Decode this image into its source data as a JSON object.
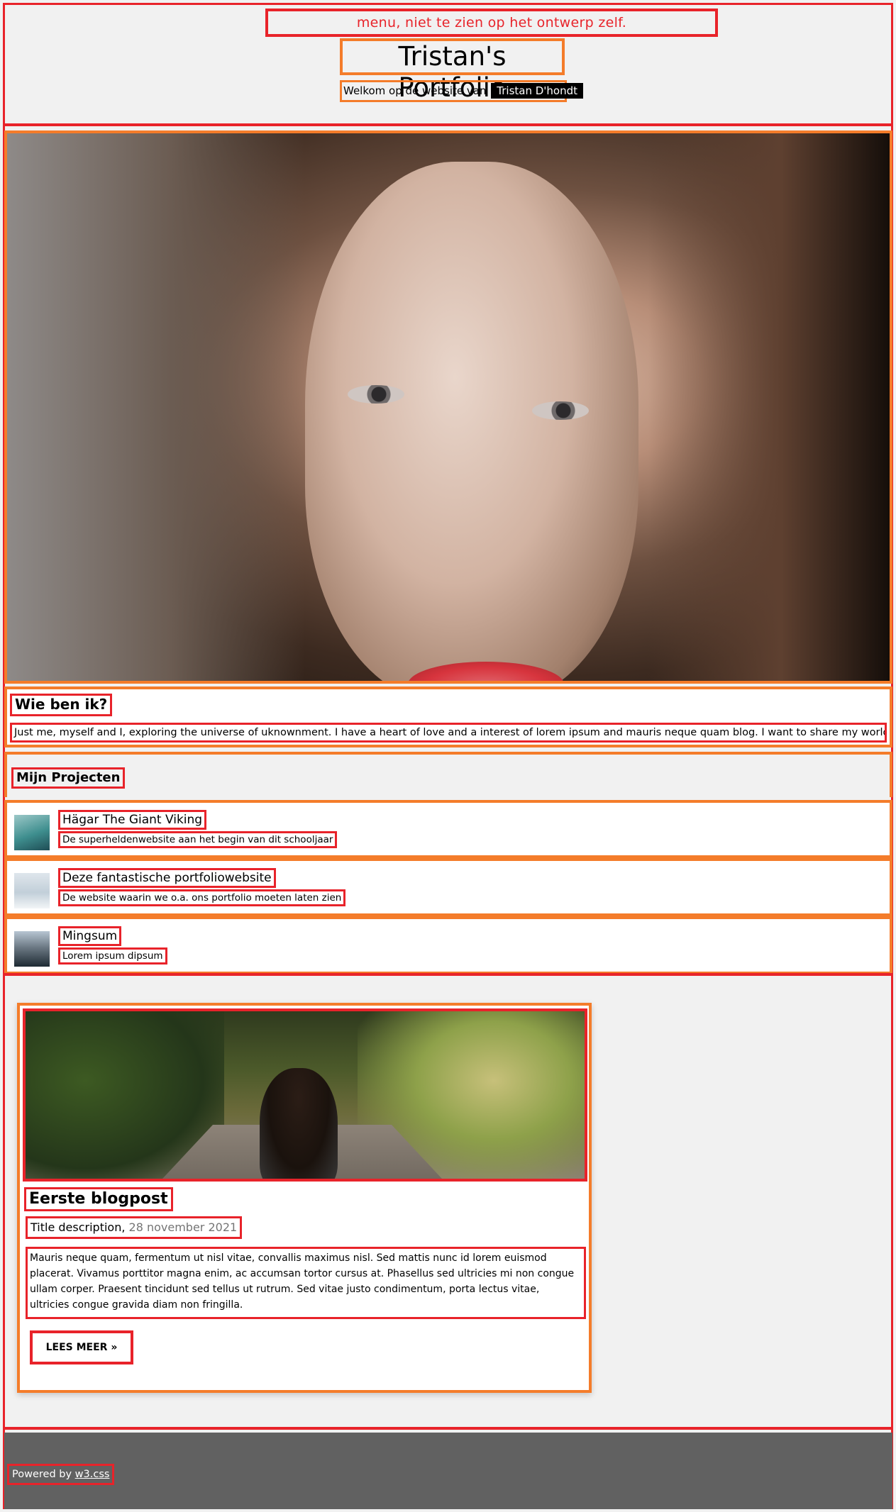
{
  "header": {
    "menu_note": "menu, niet te zien op het ontwerp zelf.",
    "site_title": "Tristan's Portfolio",
    "welcome_prefix": "Welkom op de website van",
    "owner_name": "Tristan D'hondt"
  },
  "about": {
    "title": "Wie ben ik?",
    "text": "Just me, myself and I, exploring the universe of uknownment. I have a heart of love and a interest of lorem ipsum and mauris neque quam blog. I want to share my world with you."
  },
  "projects": {
    "title": "Mijn Projecten",
    "items": [
      {
        "title": "Hägar The Giant Viking",
        "description": "De superheldenwebsite aan het begin van dit schooljaar"
      },
      {
        "title": "Deze fantastische portfoliowebsite",
        "description": "De website waarin we o.a. ons portfolio moeten laten zien"
      },
      {
        "title": "Mingsum",
        "description": "Lorem ipsum dipsum"
      }
    ]
  },
  "blog": {
    "title": "Eerste blogpost",
    "subtitle": "Title description,",
    "date": "28 november 2021",
    "body": "Mauris neque quam, fermentum ut nisl vitae, convallis maximus nisl. Sed mattis nunc id lorem euismod placerat. Vivamus porttitor magna enim, ac accumsan tortor cursus at. Phasellus sed ultricies mi non congue ullam corper. Praesent tincidunt sed tellus ut rutrum. Sed vitae justo condimentum, porta lectus vitae, ultricies congue gravida diam non fringilla.",
    "read_more_label": "LEES MEER »"
  },
  "footer": {
    "prefix": "Powered by",
    "link_text": "w3.css"
  },
  "colors": {
    "annotation_red": "#e8232a",
    "annotation_orange": "#f47c2a",
    "footer_bg": "#616161",
    "page_bg": "#f1f1f1"
  }
}
